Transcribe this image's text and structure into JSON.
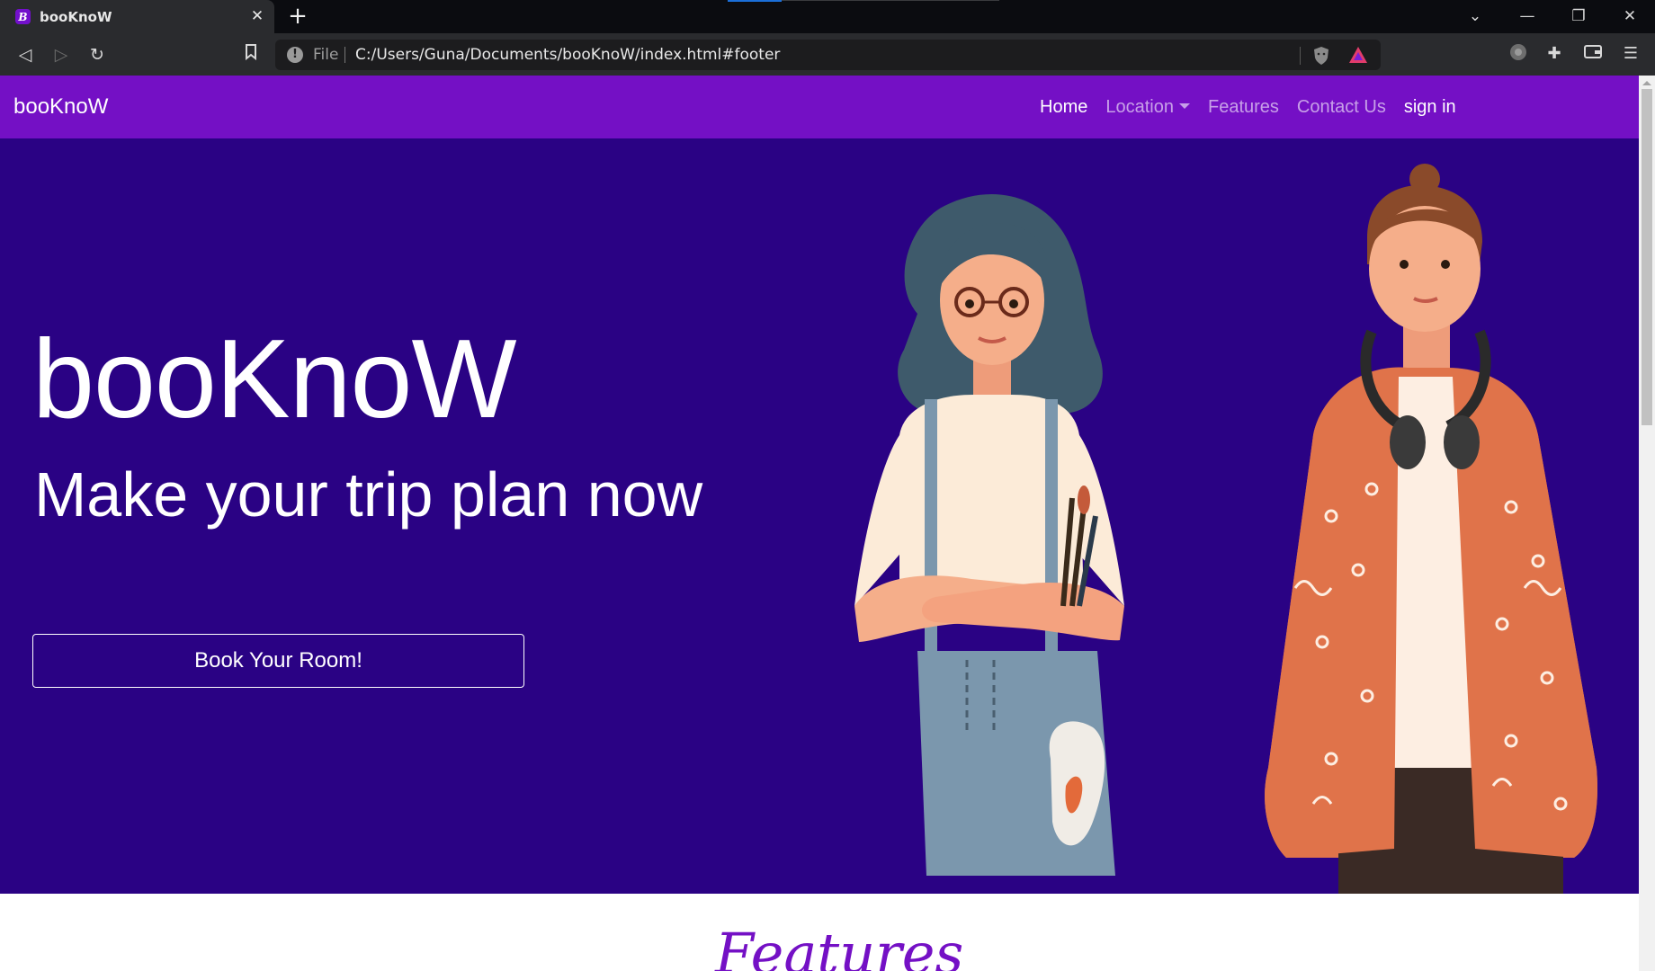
{
  "browser": {
    "tab_title": "booKnoW",
    "favicon_letter": "B",
    "new_tab": "+",
    "url_scheme_label": "File",
    "url": "C:/Users/Guna/Documents/booKnoW/index.html#footer"
  },
  "nav": {
    "brand": "booKnoW",
    "links": [
      "Home",
      "Location",
      "Features",
      "Contact Us",
      "sign in"
    ]
  },
  "hero": {
    "title": "booKnoW",
    "subtitle": "Make your trip plan now",
    "button": "Book Your Room!"
  },
  "features": {
    "heading": "Features"
  },
  "colors": {
    "navbar": "#7410c5",
    "hero_bg": "#2a0284",
    "accent": "#7410c5"
  },
  "icons": [
    "back-icon",
    "forward-icon",
    "reload-icon",
    "bookmark-icon",
    "info-icon",
    "brave-shield-icon",
    "brave-rewards-icon",
    "profile-icon",
    "extensions-icon",
    "wallet-icon",
    "menu-icon",
    "close-icon",
    "minimize-icon",
    "restore-icon",
    "tab-list-icon"
  ]
}
